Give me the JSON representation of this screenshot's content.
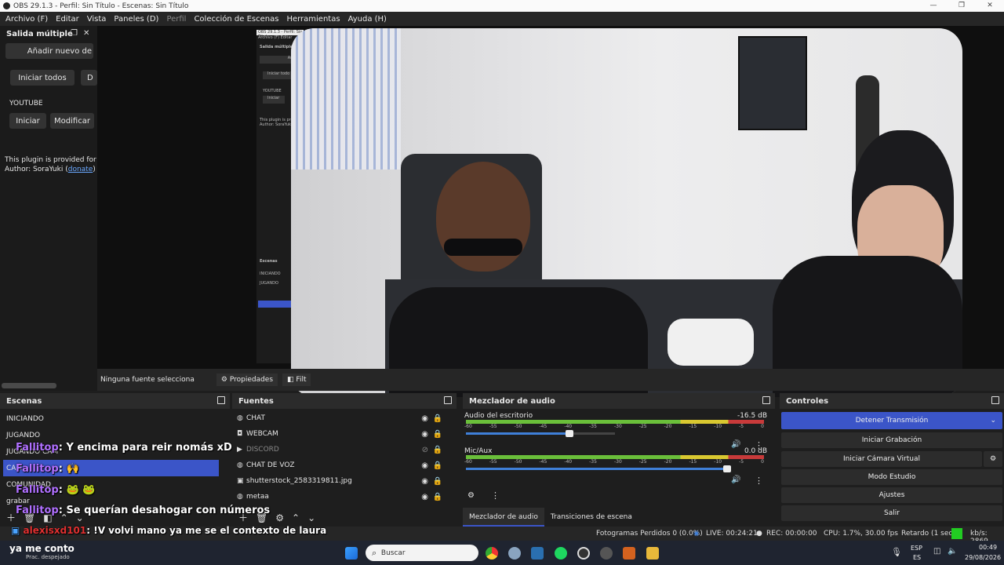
{
  "window": {
    "title": "OBS 29.1.3 - Perfil: Sin Título - Escenas: Sin Título"
  },
  "menu": [
    "Archivo (F)",
    "Editar",
    "Vista",
    "Paneles (D)",
    "Perfil",
    "Colección de Escenas",
    "Herramientas",
    "Ayuda (H)"
  ],
  "multi": {
    "title": "Salida múltiple",
    "add": "Añadir nuevo de",
    "start_all": "Iniciar todos",
    "stop_all": "D",
    "target": "YOUTUBE",
    "start": "Iniciar",
    "modify": "Modificar",
    "info": "This plugin is provided for fr",
    "author_prefix": "Author: SoraYuki (",
    "donate": "donate",
    "author_suffix": ")"
  },
  "preview": {
    "no_source": "Ninguna fuente selecciona",
    "properties": "Propiedades",
    "filters": "Filt"
  },
  "scenes": {
    "title": "Escenas",
    "items": [
      "INICIANDO",
      "JUGANDO",
      "JUGANDO CAM",
      "CAM",
      "COMUNIDAD",
      "grabar"
    ],
    "selected": 3
  },
  "sources": {
    "title": "Fuentes",
    "items": [
      {
        "name": "CHAT",
        "icon": "globe-icon",
        "hidden": false
      },
      {
        "name": "WEBCAM",
        "icon": "camera-icon",
        "hidden": false
      },
      {
        "name": "DISCORD",
        "icon": "play-icon",
        "hidden": true
      },
      {
        "name": "CHAT DE VOZ",
        "icon": "globe-icon",
        "hidden": false
      },
      {
        "name": "shutterstock_2583319811.jpg",
        "icon": "image-icon",
        "hidden": false
      },
      {
        "name": "metaa",
        "icon": "globe-icon",
        "hidden": false
      }
    ]
  },
  "mixer": {
    "title": "Mezclador de audio",
    "ch1": {
      "name": "Audio del escritorio",
      "db": "-16.5 dB",
      "vol": 0.72
    },
    "ch2": {
      "name": "Mic/Aux",
      "db": "0.0 dB",
      "vol": 1.0
    },
    "scale": [
      "-60",
      "-55",
      "-50",
      "-45",
      "-40",
      "-35",
      "-30",
      "-25",
      "-20",
      "-15",
      "-10",
      "-5",
      "0"
    ],
    "tabs": [
      "Mezclador de audio",
      "Transiciones de escena"
    ]
  },
  "controls": {
    "title": "Controles",
    "stop_stream": "Detener Transmisión",
    "start_rec": "Iniciar Grabación",
    "virtual_cam": "Iniciar Cámara Virtual",
    "studio": "Modo Estudio",
    "settings": "Ajustes",
    "exit": "Salir"
  },
  "status": {
    "dropped": "Fotogramas Perdidos 0 (0.0%)",
    "live": "LIVE: 00:24:21",
    "rec": "REC: 00:00:00",
    "cpu": "CPU: 1.7%, 30.00 fps",
    "delay": "Retardo (1 sec)",
    "kbs": "kb/s: 2869"
  },
  "chat": [
    {
      "name": "Fallitop",
      "text": ": Y encima para reir nomás xD"
    },
    {
      "name": "Fallitop",
      "text": ": 🙌"
    },
    {
      "name": "Fallitop",
      "text": ":  🐸 🐸"
    },
    {
      "name": "Fallitop",
      "text": ": Se querían desahogar con números"
    },
    {
      "name": "alexisxd101",
      "text": ": !V volvi mano ya me se el contexto de laura"
    }
  ],
  "inner": {
    "title": "OBS 29.1.3 - Perfil: Sin Título",
    "menu": "Archivo (F)   Editar",
    "dock": "Salida múltiple",
    "add": "Añadi",
    "start": "Iniciar todo",
    "yt": "YOUTUBE",
    "ini": "Iniciar",
    "info": "This plugin is provi",
    "author": "Author: SoraYuki",
    "scenes": "Escenas",
    "s1": "INICIANDO",
    "s2": "JUGANDO"
  },
  "weather": {
    "title": "ya me conto",
    "sub": "Prac. despejado"
  },
  "taskbar": {
    "search": "Buscar",
    "lang": "ESP",
    "lang2": "ES",
    "time": "00:49",
    "date": "29/08/2026"
  },
  "colors": {
    "accent": "#3b55c8",
    "live_green": "#22cc22"
  }
}
